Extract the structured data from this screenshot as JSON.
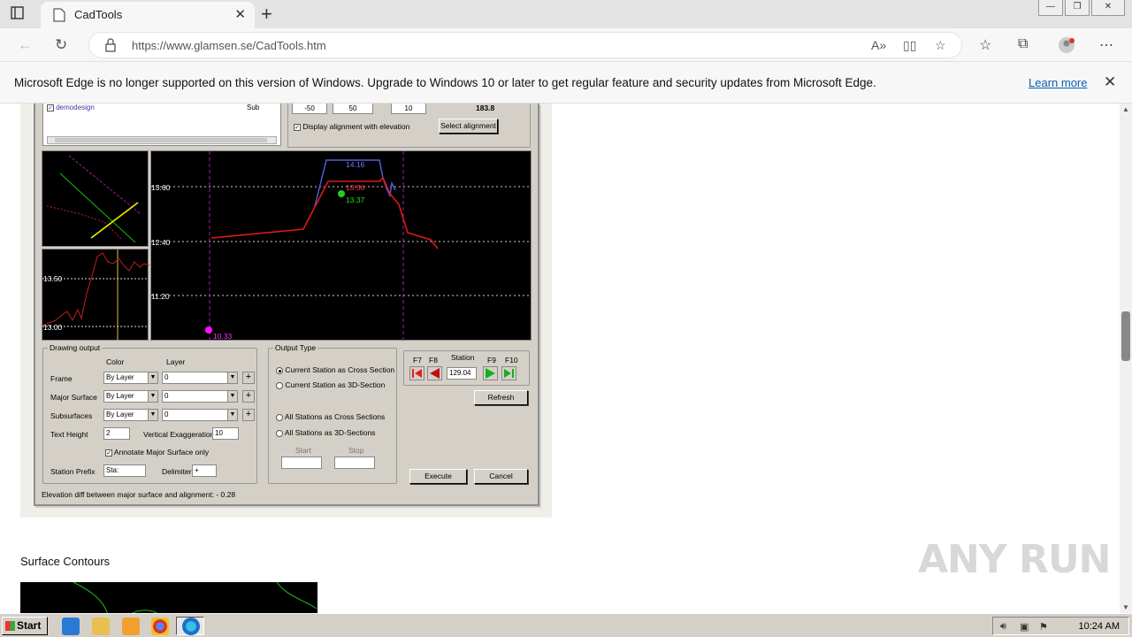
{
  "browser": {
    "tab_title": "CadTools",
    "url": "https://www.glamsen.se/CadTools.htm",
    "infobar_message": "Microsoft Edge is no longer supported on this version of Windows. Upgrade to Windows 10 or later to get regular feature and security updates from Microsoft Edge.",
    "infobar_link": "Learn more"
  },
  "dialog": {
    "layer_item": "demodesign",
    "layer_sub": "Sub",
    "top_values": [
      "-50",
      "50",
      "10",
      "183.8"
    ],
    "display_alignment_label": "Display alignment with elevation",
    "select_alignment_button": "Select alignment",
    "profile_labels": {
      "y1": "13.60",
      "y2": "12.40",
      "y3": "11.20",
      "blue_top": "14.16",
      "red_top": "13.56",
      "green_point": "13.37",
      "magenta_point": "10.33"
    },
    "mini_labels": {
      "top": "13.50",
      "bottom": "13.00"
    },
    "drawing_output": {
      "title": "Drawing output",
      "color_header": "Color",
      "layer_header": "Layer",
      "rows": [
        {
          "label": "Frame",
          "color": "By Layer",
          "layer": "0"
        },
        {
          "label": "Major Surface",
          "color": "By Layer",
          "layer": "0"
        },
        {
          "label": "Subsurfaces",
          "color": "By Layer",
          "layer": "0"
        }
      ],
      "text_height_label": "Text Height",
      "text_height_value": "2",
      "vertical_exaggeration_label": "Vertical Exaggeration",
      "vertical_exaggeration_value": "10",
      "annotate_label": "Annotate Major Surface only",
      "station_prefix_label": "Station Prefix",
      "station_prefix_value": "Sta:",
      "delimiter_label": "Delimiter",
      "delimiter_value": "+"
    },
    "output_type": {
      "title": "Output Type",
      "options": [
        "Current Station as Cross Section",
        "Current Station as 3D-Section",
        "All Stations as Cross Sections",
        "All Stations as 3D-Sections"
      ],
      "start_label": "Start",
      "stop_label": "Stop"
    },
    "station": {
      "f7": "F7",
      "f8": "F8",
      "f9": "F9",
      "f10": "F10",
      "label": "Station",
      "value": "129.04"
    },
    "refresh_button": "Refresh",
    "execute_button": "Execute",
    "cancel_button": "Cancel",
    "status": "Elevation diff between major surface and alignment: - 0.28"
  },
  "page": {
    "section_heading": "Surface Contours",
    "watermark": "ANY RUN"
  },
  "taskbar": {
    "start": "Start",
    "time": "10:24 AM"
  }
}
